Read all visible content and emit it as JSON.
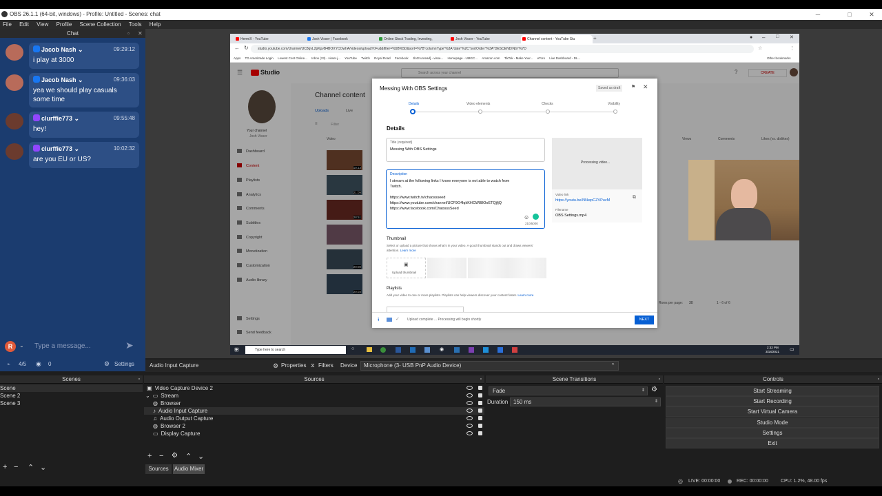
{
  "window": {
    "title": "OBS 26.1.1 (64-bit, windows) - Profile: Untitled - Scenes: chat"
  },
  "menu": [
    "File",
    "Edit",
    "View",
    "Profile",
    "Scene Collection",
    "Tools",
    "Help"
  ],
  "chat": {
    "title": "Chat",
    "messages": [
      {
        "name": "Jacob Nash",
        "platform": "facebook",
        "time": "09:29:12",
        "text": "i play at 3000"
      },
      {
        "name": "Jacob Nash",
        "platform": "facebook",
        "time": "09:36:03",
        "text": "yea we should play casuals some time"
      },
      {
        "name": "clurffie773",
        "platform": "twitch",
        "time": "09:55:48",
        "text": "hey!"
      },
      {
        "name": "clurffie773",
        "platform": "twitch",
        "time": "10:02:32",
        "text": "are you EU or US?"
      }
    ],
    "input_placeholder": "Type a message...",
    "viewers": "4/5",
    "watch_count": "0",
    "settings_label": "Settings",
    "avatar_letter": "R"
  },
  "browser": {
    "tabs": [
      "HermiX - YouTube",
      "Josh Visser | Facebook",
      "Online Stock Trading, Investing,",
      "Josh Visser - YouTube",
      "Channel content - YouTube Stu"
    ],
    "url": "studio.youtube.com/channel/UC8qvL2pKpvB4BOXYCOwhA/videos/upload?d=ud&filter=%5B%5D&sort=%7B\"columnType\"%3A\"date\"%2C\"sortOrder\"%3A\"DESCENDING\"%7D",
    "bookmarks": [
      "Apps",
      "TD Ameritrade Login",
      "Lowest Cost Online...",
      "Inbox (23) - visser.j...",
      "YouTube",
      "Twitch",
      "Royal Road",
      "Facebook",
      "Jb43 unread] - visse...",
      "Homepage - UMGC...",
      "Amazon.com",
      "TikTok - Make Your...",
      "eToro",
      "Live Dashboard - DL...",
      "Other bookmarks"
    ]
  },
  "studio": {
    "logo": "Studio",
    "search_placeholder": "Search across your channel",
    "create_label": "CREATE",
    "channel_label": "Your channel",
    "channel_name": "Josh Visser",
    "nav": [
      "Dashboard",
      "Content",
      "Playlists",
      "Analytics",
      "Comments",
      "Subtitles",
      "Copyright",
      "Monetization",
      "Customization",
      "Audio library",
      "Settings",
      "Send feedback"
    ],
    "page_title": "Channel content",
    "tabs": [
      "Uploads",
      "Live"
    ],
    "filter_label": "Filter",
    "col_video": "Video",
    "col_views": "Views",
    "col_comments": "Comments",
    "col_likes": "Likes (vs. dislikes)",
    "durations": [
      "10:13",
      "21:09",
      "28:51",
      "",
      "20:00",
      "20:03"
    ],
    "rows_label": "Rows per page:",
    "rows_value": "30",
    "range": "1 - 6 of 6"
  },
  "modal": {
    "title": "Messing With OBS Settings",
    "saved": "Saved as draft",
    "steps": [
      "Details",
      "Video elements",
      "Checks",
      "Visibility"
    ],
    "heading": "Details",
    "title_label": "Title (required)",
    "title_value": "Messing With OBS Settings",
    "desc_label": "Description",
    "desc_line1": "I stream at the following links I know everyone is not able to watch from",
    "desc_line2": "Twitch.",
    "desc_link1": "https://www.twitch.tv/chaossseed",
    "desc_link2": "https://www.youtube.com/channel/UCF9O4lqkKHCW88OoETQjfjQ",
    "desc_link3": "https://www.facebook.com/ChaosssSeed",
    "char_count": "210/5000",
    "processing": "Processing video...",
    "video_link_label": "Video link",
    "video_link": "https://youtu.be/NNwpCZVPuzM",
    "filename_label": "Filename",
    "filename": "OBS Settings.mp4",
    "thumb_heading": "Thumbnail",
    "thumb_desc": "Select or upload a picture that shows what's in your video. A good thumbnail stands out and draws viewers' attention.",
    "learn_more": "Learn more",
    "upload_thumb": "Upload thumbnail",
    "playlists_heading": "Playlists",
    "playlists_desc": "Add your video to one or more playlists. Playlists can help viewers discover your content faster.",
    "footer_status": "Upload complete ... Processing will begin shortly",
    "next": "NEXT"
  },
  "taskbar": {
    "search": "Type here to search",
    "time": "2:32 PM",
    "date": "3/18/2021"
  },
  "propbar": {
    "source": "Audio Input Capture",
    "properties": "Properties",
    "filters": "Filters",
    "device_label": "Device",
    "device_value": "Microphone (3- USB PnP Audio Device)"
  },
  "scenes": {
    "title": "Scenes",
    "items": [
      "Scene",
      "Scene 2",
      "Scene 3"
    ]
  },
  "sources": {
    "title": "Sources",
    "items": [
      "Video Capture Device 2",
      "Stream",
      "Browser",
      "Audio Input Capture",
      "Audio Output Capture",
      "Browser 2",
      "Display Capture"
    ],
    "tab_sources": "Sources",
    "tab_mixer": "Audio Mixer"
  },
  "transitions": {
    "title": "Scene Transitions",
    "value": "Fade",
    "duration_label": "Duration",
    "duration_value": "150 ms"
  },
  "controls": {
    "title": "Controls",
    "buttons": [
      "Start Streaming",
      "Start Recording",
      "Start Virtual Camera",
      "Studio Mode",
      "Settings",
      "Exit"
    ]
  },
  "status": {
    "live": "LIVE: 00:00:00",
    "rec": "REC: 00:00:00",
    "cpu": "CPU: 1.2%, 48.00 fps"
  },
  "colors": {
    "chat_bg": "#1b3c6f",
    "bubble": "#2d4f85",
    "facebook": "#1877f2",
    "twitch": "#9146ff",
    "yt_red": "#ff0000",
    "yt_blue": "#065fd4"
  }
}
